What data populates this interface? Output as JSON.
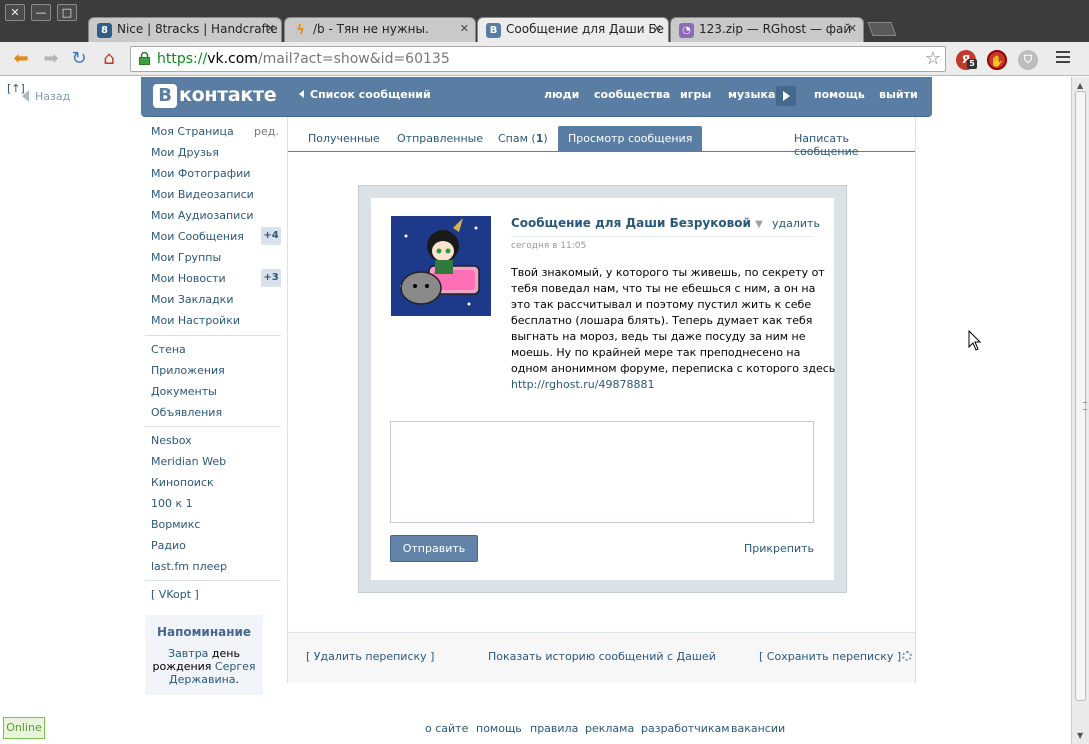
{
  "browser": {
    "tabs": [
      {
        "title": "Nice | 8tracks | Handcrafte",
        "favicon": "8tracks-icon"
      },
      {
        "title": "/b - Тян не нужны.",
        "favicon": "lightning-icon"
      },
      {
        "title": "Сообщение для Даши Бе",
        "favicon": "vk-icon",
        "active": true
      },
      {
        "title": "123.zip — RGhost — фай",
        "favicon": "ghost-icon"
      }
    ],
    "url_scheme": "https://",
    "url_host": "vk.com",
    "url_path": "/mail?act=show&id=60135",
    "ext_badge": "5"
  },
  "page": {
    "back_bracket": "[↑]",
    "back_label": "Назад"
  },
  "header": {
    "logo": "контакте",
    "logo_letter": "В",
    "crumb": "Список сообщений",
    "nav": [
      "люди",
      "сообщества",
      "игры",
      "музыка",
      "помощь",
      "выйти"
    ]
  },
  "left_menu": {
    "edit": "ред.",
    "group1": [
      {
        "label": "Моя Страница"
      },
      {
        "label": "Мои Друзья"
      },
      {
        "label": "Мои Фотографии"
      },
      {
        "label": "Мои Видеозаписи"
      },
      {
        "label": "Мои Аудиозаписи"
      },
      {
        "label": "Мои Сообщения",
        "badge": "+4"
      },
      {
        "label": "Мои Группы"
      },
      {
        "label": "Мои Новости",
        "badge": "+3"
      },
      {
        "label": "Мои Закладки"
      },
      {
        "label": "Мои Настройки"
      }
    ],
    "group2": [
      "Стена",
      "Приложения",
      "Документы",
      "Объявления"
    ],
    "group3": [
      "Nesbox",
      "Meridian Web",
      "Кинопоиск",
      "100 к 1",
      "Вормикс",
      "Радио",
      "last.fm плеер"
    ],
    "vkopt": "[ VKopt ]"
  },
  "reminder": {
    "title": "Напоминание",
    "link1": "Завтра",
    "text1": " день",
    "text2": "рождения ",
    "link2": "Сергея",
    "link3": "Державина",
    "dot": "."
  },
  "mail_tabs": {
    "received": "Полученные",
    "sent": "Отправленные",
    "spam": "Спам (",
    "spam_count": "1",
    "spam_end": ")",
    "view": "Просмотр сообщения",
    "compose": "Написать сообщение"
  },
  "message": {
    "title": "Сообщение для Даши Безруковой",
    "delete": "удалить",
    "date": "сегодня в 11:05",
    "lines": [
      "Твой знакомый, у которого ты живешь, по секрету от",
      "тебя поведал нам, что ты не ебешься с ним, а он на",
      "это так рассчитывал и поэтому пустил жить к себе",
      "бесплатно (лошара блять). Теперь думает как тебя",
      "выгнать на мороз, ведь ты даже посуду за ним не",
      "моешь. Ну по крайней мере так преподнесено на",
      "одном анонимном форуме, переписка с которого здесь"
    ],
    "link": "http://rghost.ru/49878881",
    "send": "Отправить",
    "attach": "Прикрепить"
  },
  "panel_footer": {
    "delete_history": "[ Удалить переписку ]",
    "show_history": "Показать историю сообщений с Дашей",
    "save_history": "[ Сохранить переписку ]"
  },
  "footer": {
    "links": [
      "о сайте",
      "помощь",
      "правила",
      "реклама",
      "разработчикам",
      "вакансии"
    ],
    "online": "Online"
  },
  "colors": {
    "vk_blue": "#597da3",
    "link": "#2b587a"
  }
}
